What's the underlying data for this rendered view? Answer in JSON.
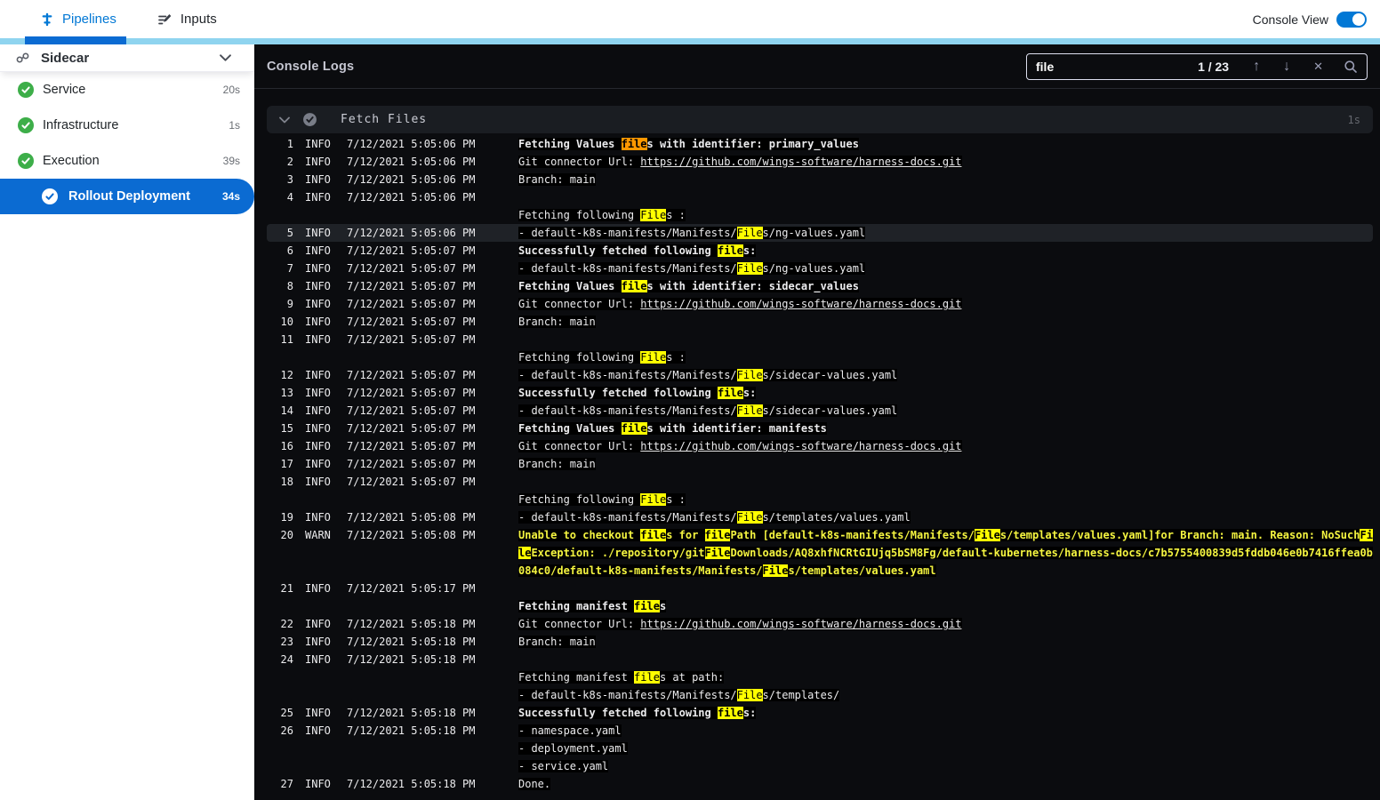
{
  "topbar": {
    "tabs": [
      {
        "label": "Pipelines",
        "active": true
      },
      {
        "label": "Inputs",
        "active": false
      }
    ],
    "console_view_label": "Console View",
    "console_view_on": true
  },
  "icons": {
    "up_arrow": "↑",
    "down_arrow": "↓",
    "close": "✕"
  },
  "colors": {
    "accent_blue": "#0278d5",
    "selected_blue": "#0b6bd2",
    "strip_blue": "#8fd4ef",
    "success_green": "#3dae49",
    "warn_yellow": "#f5f540",
    "match_highlight": "#ffff00",
    "current_match_highlight": "#ff9800",
    "panel_bg": "#0b0c0f"
  },
  "sidebar": {
    "title": "Sidecar",
    "stages": [
      {
        "label": "Service",
        "time": "20s",
        "status": "success",
        "selected": false
      },
      {
        "label": "Infrastructure",
        "time": "1s",
        "status": "success",
        "selected": false
      },
      {
        "label": "Execution",
        "time": "39s",
        "status": "success",
        "selected": false
      },
      {
        "label": "Rollout Deployment",
        "time": "34s",
        "status": "success",
        "selected": true
      }
    ]
  },
  "console": {
    "title": "Console Logs",
    "search": {
      "value": "file",
      "count": "1 / 23"
    },
    "step": {
      "title": "Fetch Files",
      "duration": "1s"
    }
  },
  "log": {
    "entries": [
      {
        "n": 1,
        "lvl": "INFO",
        "time": "7/12/2021 5:05:06 PM",
        "lines": [
          {
            "b": true,
            "segs": [
              {
                "t": "Fetching Values "
              },
              {
                "t": "file",
                "h": "cur"
              },
              {
                "t": "s with identifier: primary_values"
              }
            ]
          }
        ]
      },
      {
        "n": 2,
        "lvl": "INFO",
        "time": "7/12/2021 5:05:06 PM",
        "lines": [
          {
            "segs": [
              {
                "t": "Git connector Url: "
              },
              {
                "t": "https://github.com/wings-software/harness-docs.git",
                "link": true
              }
            ]
          }
        ]
      },
      {
        "n": 3,
        "lvl": "INFO",
        "time": "7/12/2021 5:05:06 PM",
        "lines": [
          {
            "segs": [
              {
                "t": "Branch: main"
              }
            ]
          }
        ]
      },
      {
        "n": 4,
        "lvl": "INFO",
        "time": "7/12/2021 5:05:06 PM",
        "lines": [
          {
            "segs": []
          },
          {
            "segs": [
              {
                "t": "Fetching following "
              },
              {
                "t": "File",
                "h": "m"
              },
              {
                "t": "s :"
              }
            ]
          }
        ]
      },
      {
        "n": 5,
        "lvl": "INFO",
        "time": "7/12/2021 5:05:06 PM",
        "active": true,
        "lines": [
          {
            "segs": [
              {
                "t": "- default-k8s-manifests/Manifests/"
              },
              {
                "t": "File",
                "h": "m"
              },
              {
                "t": "s/ng-values.yaml"
              }
            ]
          }
        ]
      },
      {
        "n": 6,
        "lvl": "INFO",
        "time": "7/12/2021 5:05:07 PM",
        "lines": [
          {
            "b": true,
            "segs": [
              {
                "t": "Successfully fetched following "
              },
              {
                "t": "file",
                "h": "m"
              },
              {
                "t": "s:"
              }
            ]
          }
        ]
      },
      {
        "n": 7,
        "lvl": "INFO",
        "time": "7/12/2021 5:05:07 PM",
        "lines": [
          {
            "segs": [
              {
                "t": "- default-k8s-manifests/Manifests/"
              },
              {
                "t": "File",
                "h": "m"
              },
              {
                "t": "s/ng-values.yaml"
              }
            ]
          }
        ]
      },
      {
        "n": 8,
        "lvl": "INFO",
        "time": "7/12/2021 5:05:07 PM",
        "lines": [
          {
            "b": true,
            "segs": [
              {
                "t": "Fetching Values "
              },
              {
                "t": "file",
                "h": "m"
              },
              {
                "t": "s with identifier: sidecar_values"
              }
            ]
          }
        ]
      },
      {
        "n": 9,
        "lvl": "INFO",
        "time": "7/12/2021 5:05:07 PM",
        "lines": [
          {
            "segs": [
              {
                "t": "Git connector Url: "
              },
              {
                "t": "https://github.com/wings-software/harness-docs.git",
                "link": true
              }
            ]
          }
        ]
      },
      {
        "n": 10,
        "lvl": "INFO",
        "time": "7/12/2021 5:05:07 PM",
        "lines": [
          {
            "segs": [
              {
                "t": "Branch: main"
              }
            ]
          }
        ]
      },
      {
        "n": 11,
        "lvl": "INFO",
        "time": "7/12/2021 5:05:07 PM",
        "lines": [
          {
            "segs": []
          },
          {
            "segs": [
              {
                "t": "Fetching following "
              },
              {
                "t": "File",
                "h": "m"
              },
              {
                "t": "s :"
              }
            ]
          }
        ]
      },
      {
        "n": 12,
        "lvl": "INFO",
        "time": "7/12/2021 5:05:07 PM",
        "lines": [
          {
            "segs": [
              {
                "t": "- default-k8s-manifests/Manifests/"
              },
              {
                "t": "File",
                "h": "m"
              },
              {
                "t": "s/sidecar-values.yaml"
              }
            ]
          }
        ]
      },
      {
        "n": 13,
        "lvl": "INFO",
        "time": "7/12/2021 5:05:07 PM",
        "lines": [
          {
            "b": true,
            "segs": [
              {
                "t": "Successfully fetched following "
              },
              {
                "t": "file",
                "h": "m"
              },
              {
                "t": "s:"
              }
            ]
          }
        ]
      },
      {
        "n": 14,
        "lvl": "INFO",
        "time": "7/12/2021 5:05:07 PM",
        "lines": [
          {
            "segs": [
              {
                "t": "- default-k8s-manifests/Manifests/"
              },
              {
                "t": "File",
                "h": "m"
              },
              {
                "t": "s/sidecar-values.yaml"
              }
            ]
          }
        ]
      },
      {
        "n": 15,
        "lvl": "INFO",
        "time": "7/12/2021 5:05:07 PM",
        "lines": [
          {
            "b": true,
            "segs": [
              {
                "t": "Fetching Values "
              },
              {
                "t": "file",
                "h": "m"
              },
              {
                "t": "s with identifier: manifests"
              }
            ]
          }
        ]
      },
      {
        "n": 16,
        "lvl": "INFO",
        "time": "7/12/2021 5:05:07 PM",
        "lines": [
          {
            "segs": [
              {
                "t": "Git connector Url: "
              },
              {
                "t": "https://github.com/wings-software/harness-docs.git",
                "link": true
              }
            ]
          }
        ]
      },
      {
        "n": 17,
        "lvl": "INFO",
        "time": "7/12/2021 5:05:07 PM",
        "lines": [
          {
            "segs": [
              {
                "t": "Branch: main"
              }
            ]
          }
        ]
      },
      {
        "n": 18,
        "lvl": "INFO",
        "time": "7/12/2021 5:05:07 PM",
        "lines": [
          {
            "segs": []
          },
          {
            "segs": [
              {
                "t": "Fetching following "
              },
              {
                "t": "File",
                "h": "m"
              },
              {
                "t": "s :"
              }
            ]
          }
        ]
      },
      {
        "n": 19,
        "lvl": "INFO",
        "time": "7/12/2021 5:05:08 PM",
        "lines": [
          {
            "segs": [
              {
                "t": "- default-k8s-manifests/Manifests/"
              },
              {
                "t": "File",
                "h": "m"
              },
              {
                "t": "s/templates/values.yaml"
              }
            ]
          }
        ]
      },
      {
        "n": 20,
        "lvl": "WARN",
        "time": "7/12/2021 5:05:08 PM",
        "lines": [
          {
            "w": true,
            "segs": [
              {
                "t": "Unable to checkout "
              },
              {
                "t": "file",
                "h": "m"
              },
              {
                "t": "s for "
              },
              {
                "t": "file",
                "h": "m"
              },
              {
                "t": "Path [default-k8s-manifests/Manifests/"
              },
              {
                "t": "File",
                "h": "m"
              },
              {
                "t": "s/templates/values.yaml]for Branch: main. Reason: NoSuch"
              },
              {
                "t": "File",
                "h": "m"
              },
              {
                "t": "Exception: ./repository/git"
              },
              {
                "t": "File",
                "h": "m"
              },
              {
                "t": "Downloads/AQ8xhfNCRtGIUjq5bSM8Fg/default-kubernetes/harness-docs/c7b5755400839d5fddb046e0b7416ffea0b084c0/default-k8s-manifests/Manifests/"
              },
              {
                "t": "File",
                "h": "m"
              },
              {
                "t": "s/templates/values.yaml"
              }
            ]
          }
        ]
      },
      {
        "n": 21,
        "lvl": "INFO",
        "time": "7/12/2021 5:05:17 PM",
        "lines": [
          {
            "segs": []
          },
          {
            "b": true,
            "segs": [
              {
                "t": "Fetching manifest "
              },
              {
                "t": "file",
                "h": "m"
              },
              {
                "t": "s"
              }
            ]
          }
        ]
      },
      {
        "n": 22,
        "lvl": "INFO",
        "time": "7/12/2021 5:05:18 PM",
        "lines": [
          {
            "segs": [
              {
                "t": "Git connector Url: "
              },
              {
                "t": "https://github.com/wings-software/harness-docs.git",
                "link": true
              }
            ]
          }
        ]
      },
      {
        "n": 23,
        "lvl": "INFO",
        "time": "7/12/2021 5:05:18 PM",
        "lines": [
          {
            "segs": [
              {
                "t": "Branch: main"
              }
            ]
          }
        ]
      },
      {
        "n": 24,
        "lvl": "INFO",
        "time": "7/12/2021 5:05:18 PM",
        "lines": [
          {
            "segs": []
          },
          {
            "segs": [
              {
                "t": "Fetching manifest "
              },
              {
                "t": "file",
                "h": "m"
              },
              {
                "t": "s at path:"
              }
            ]
          },
          {
            "segs": [
              {
                "t": "- default-k8s-manifests/Manifests/"
              },
              {
                "t": "File",
                "h": "m"
              },
              {
                "t": "s/templates/"
              }
            ]
          }
        ]
      },
      {
        "n": 25,
        "lvl": "INFO",
        "time": "7/12/2021 5:05:18 PM",
        "lines": [
          {
            "b": true,
            "segs": [
              {
                "t": "Successfully fetched following "
              },
              {
                "t": "file",
                "h": "m"
              },
              {
                "t": "s:"
              }
            ]
          }
        ]
      },
      {
        "n": 26,
        "lvl": "INFO",
        "time": "7/12/2021 5:05:18 PM",
        "lines": [
          {
            "segs": [
              {
                "t": "- namespace.yaml"
              }
            ]
          },
          {
            "segs": [
              {
                "t": "- deployment.yaml"
              }
            ]
          },
          {
            "segs": [
              {
                "t": "- service.yaml"
              }
            ]
          }
        ]
      },
      {
        "n": 27,
        "lvl": "INFO",
        "time": "7/12/2021 5:05:18 PM",
        "lines": [
          {
            "segs": [
              {
                "t": "Done."
              }
            ]
          }
        ]
      }
    ]
  }
}
